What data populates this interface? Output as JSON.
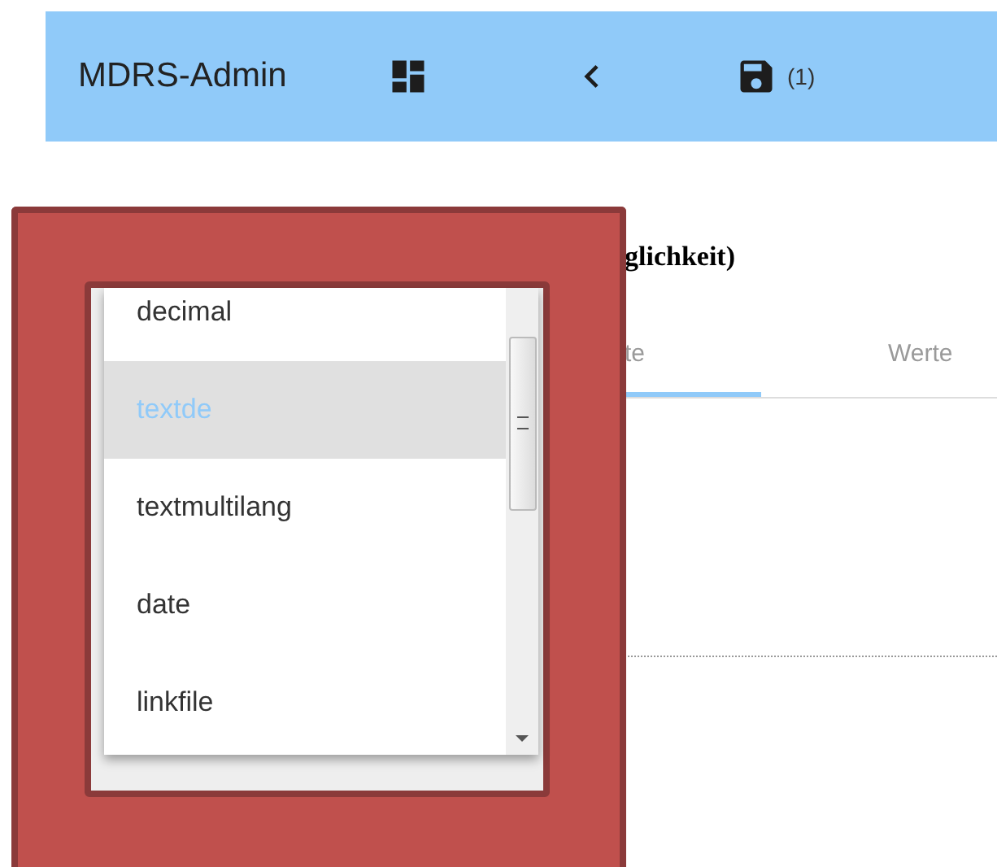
{
  "app_bar": {
    "title": "MDRS-Admin",
    "save_count": "(1)"
  },
  "heading": "glichkeit)",
  "tabs": [
    {
      "label": "te",
      "selected": true
    },
    {
      "label": "Werte",
      "selected": false
    }
  ],
  "dropdown": {
    "options": [
      {
        "label": "decimal",
        "selected": false
      },
      {
        "label": "textde",
        "selected": true
      },
      {
        "label": "textmultilang",
        "selected": false
      },
      {
        "label": "date",
        "selected": false
      },
      {
        "label": "linkfile",
        "selected": false
      }
    ]
  }
}
